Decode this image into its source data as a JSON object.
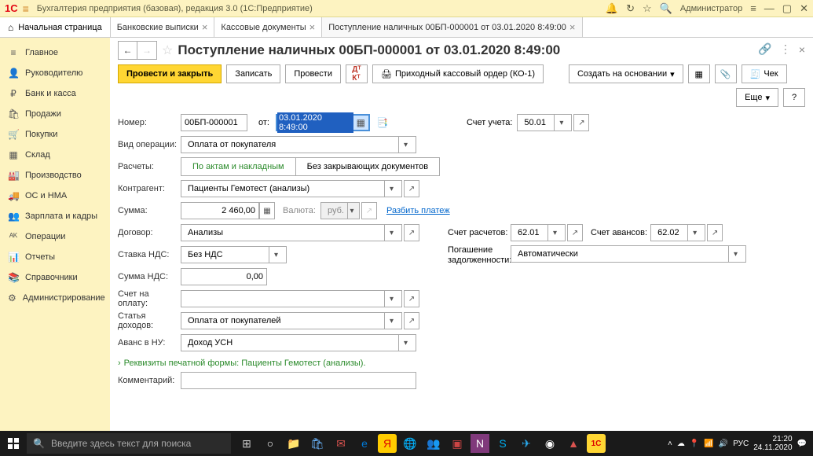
{
  "titlebar": {
    "logo": "1C",
    "text": "Бухгалтерия предприятия (базовая), редакция 3.0  (1С:Предприятие)",
    "user": "Администратор"
  },
  "tabs": {
    "home": "Начальная страница",
    "items": [
      {
        "label": "Банковские выписки"
      },
      {
        "label": "Кассовые документы"
      },
      {
        "label": "Поступление наличных 00БП-000001 от 03.01.2020 8:49:00",
        "active": true
      }
    ]
  },
  "sidebar": [
    {
      "icon": "≡",
      "label": "Главное"
    },
    {
      "icon": "👤",
      "label": "Руководителю"
    },
    {
      "icon": "₽",
      "label": "Банк и касса"
    },
    {
      "icon": "🛍",
      "label": "Продажи"
    },
    {
      "icon": "🛒",
      "label": "Покупки"
    },
    {
      "icon": "▦",
      "label": "Склад"
    },
    {
      "icon": "🏭",
      "label": "Производство"
    },
    {
      "icon": "🚚",
      "label": "ОС и НМА"
    },
    {
      "icon": "👥",
      "label": "Зарплата и кадры"
    },
    {
      "icon": "ᴬᴷ",
      "label": "Операции"
    },
    {
      "icon": "📊",
      "label": "Отчеты"
    },
    {
      "icon": "📚",
      "label": "Справочники"
    },
    {
      "icon": "⚙",
      "label": "Администрирование"
    }
  ],
  "page": {
    "title": "Поступление наличных 00БП-000001 от 03.01.2020 8:49:00"
  },
  "toolbar": {
    "post_close": "Провести и закрыть",
    "save": "Записать",
    "post": "Провести",
    "dt_kt": "Дт/Кт",
    "print_order": "Приходный кассовый ордер (КО-1)",
    "create_based": "Создать на основании",
    "check": "Чек",
    "more": "Еще",
    "help": "?"
  },
  "form": {
    "number_label": "Номер:",
    "number": "00БП-000001",
    "from_label": "от:",
    "date": "03.01.2020  8:49:00",
    "account_label": "Счет учета:",
    "account": "50.01",
    "optype_label": "Вид операции:",
    "optype": "Оплата от покупателя",
    "calc_label": "Расчеты:",
    "calc_opt1": "По актам и накладным",
    "calc_opt2": "Без закрывающих документов",
    "counterparty_label": "Контрагент:",
    "counterparty": "Пациенты Гемотест (анализы)",
    "sum_label": "Сумма:",
    "sum": "2 460,00",
    "currency_label": "Валюта:",
    "currency": "руб.",
    "split_link": "Разбить платеж",
    "contract_label": "Договор:",
    "contract": "Анализы",
    "calc_acct_label": "Счет расчетов:",
    "calc_acct": "62.01",
    "adv_acct_label": "Счет авансов:",
    "adv_acct": "62.02",
    "vat_rate_label": "Ставка НДС:",
    "vat_rate": "Без НДС",
    "debt_label": "Погашение задолженности:",
    "debt": "Автоматически",
    "vat_sum_label": "Сумма НДС:",
    "vat_sum": "0,00",
    "payacct_label": "Счет на оплату:",
    "payacct": "",
    "income_label": "Статья доходов:",
    "income": "Оплата от покупателей",
    "advance_label": "Аванс в НУ:",
    "advance": "Доход УСН",
    "requisites_link": "Реквизиты печатной формы: Пациенты Гемотест (анализы).",
    "comment_label": "Комментарий:",
    "comment": ""
  },
  "taskbar": {
    "search_placeholder": "Введите здесь текст для поиска",
    "time": "21:20",
    "date": "24.11.2020",
    "lang": "РУС"
  }
}
